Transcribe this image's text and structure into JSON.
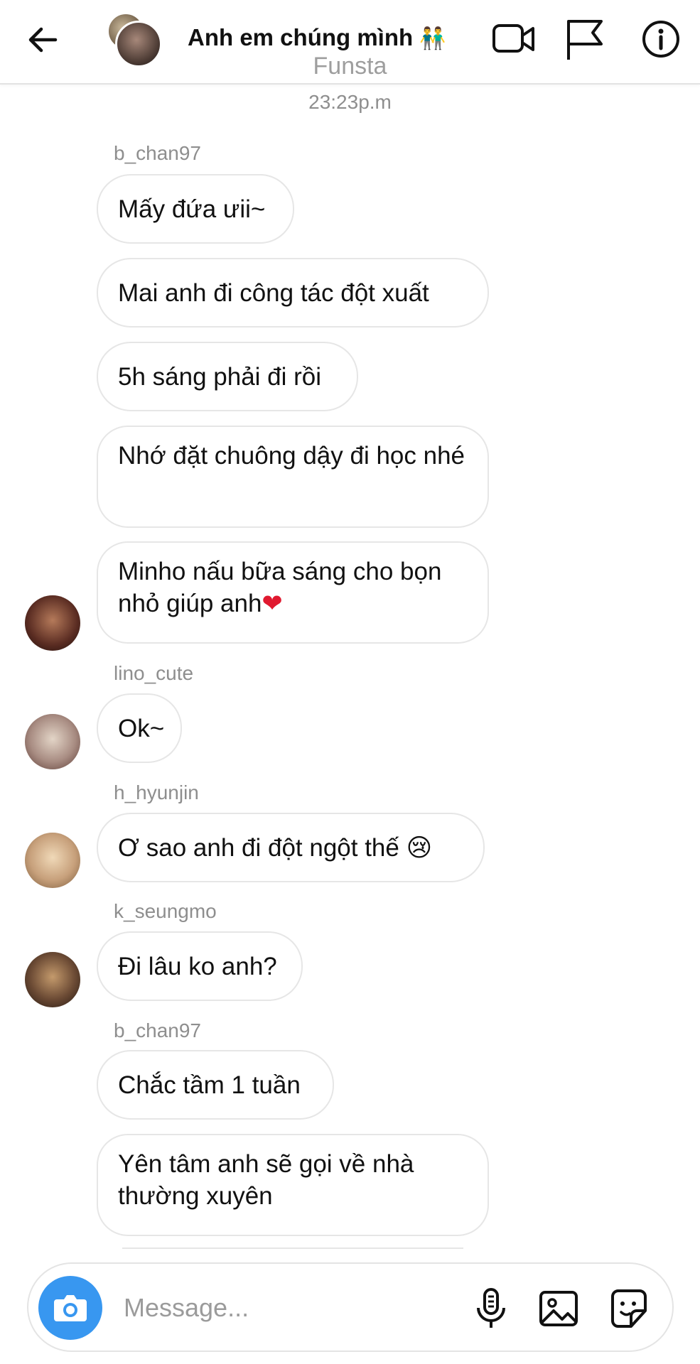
{
  "header": {
    "title": "Anh em chúng mình",
    "title_emoji": "👬",
    "icons": [
      "back-arrow-icon",
      "video-call-icon",
      "flag-icon",
      "info-icon"
    ]
  },
  "meta": {
    "app_label": "Funsta",
    "time": "23:23p.m"
  },
  "messages": [
    {
      "username": "b_chan97",
      "bubbles": [
        "Mấy đứa ưii~",
        "Mai anh đi công tác đột xuất",
        "5h sáng phải đi rồi",
        "Nhớ đặt chuông dậy đi học nhé",
        "Minho nấu bữa sáng cho bọn nhỏ giúp anh"
      ],
      "heart": "❤"
    },
    {
      "username": "lino_cute",
      "bubbles": [
        "Ok~"
      ]
    },
    {
      "username": "h_hyunjin",
      "bubbles": [
        "Ơ sao anh đi đột ngột thế 😢"
      ]
    },
    {
      "username": "k_seungmo",
      "bubbles": [
        "Đi lâu ko anh?"
      ]
    },
    {
      "username": "b_chan97",
      "bubbles": [
        "Chắc tầm 1 tuần",
        "Yên tâm anh sẽ gọi về nhà thường xuyên"
      ]
    }
  ],
  "composer": {
    "placeholder": "Message...",
    "icons": [
      "camera-icon",
      "microphone-icon",
      "gallery-icon",
      "sticker-icon"
    ]
  },
  "colors": {
    "accent": "#3897f0",
    "bubble_border": "#e6e6e6",
    "muted_text": "#8e8e8e"
  }
}
